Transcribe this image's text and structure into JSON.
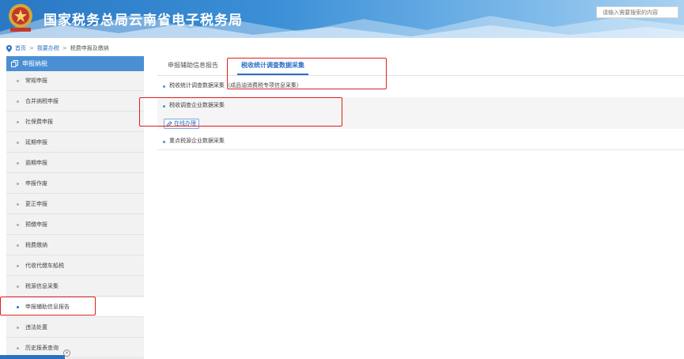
{
  "header": {
    "title": "国家税务总局云南省电子税务局",
    "search_placeholder": "请输入需要搜索的内容",
    "logo_icon": "tax-emblem-icon"
  },
  "breadcrumb": {
    "home": "首页",
    "level1": "我要办税",
    "level2": "税费申报及缴纳",
    "separator": ">"
  },
  "sidebar": {
    "heading": "申报纳税",
    "items": [
      {
        "label": "常规申报"
      },
      {
        "label": "合并纳税申报"
      },
      {
        "label": "社保费申报"
      },
      {
        "label": "延期申报"
      },
      {
        "label": "逾期申报"
      },
      {
        "label": "申报作废"
      },
      {
        "label": "更正申报"
      },
      {
        "label": "预缴申报"
      },
      {
        "label": "税费缴纳"
      },
      {
        "label": "代收代缴车船税"
      },
      {
        "label": "税源信息采集"
      },
      {
        "label": "申报辅助信息报告",
        "active": true
      },
      {
        "label": "违法处置"
      },
      {
        "label": "历史报表查询"
      }
    ]
  },
  "tabs": [
    {
      "label": "申报辅助信息报告"
    },
    {
      "label": "税收统计调查数据采集",
      "active": true
    }
  ],
  "content": {
    "items": [
      {
        "label": "税收统计调查数据采集（成品油消费税专项信息采集）"
      },
      {
        "label": "税收调查企业数据采集",
        "button": "在线办理"
      },
      {
        "label": "重点税源企业数据采集"
      }
    ]
  },
  "bottom": {
    "close_symbol": "×"
  },
  "colors": {
    "accent": "#2b6fc4",
    "header_start": "#2a78c4",
    "sidebar_head": "#4a8fd4",
    "annotation": "#e01f1f"
  }
}
